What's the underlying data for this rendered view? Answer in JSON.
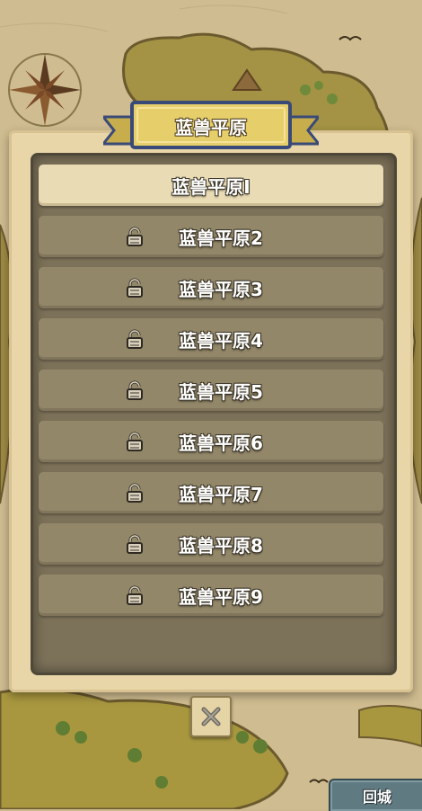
{
  "header": {
    "title": "蓝兽平原"
  },
  "levels": [
    {
      "label": "蓝兽平原Ⅰ",
      "locked": false,
      "selected": true
    },
    {
      "label": "蓝兽平原2",
      "locked": true,
      "selected": false
    },
    {
      "label": "蓝兽平原3",
      "locked": true,
      "selected": false
    },
    {
      "label": "蓝兽平原4",
      "locked": true,
      "selected": false
    },
    {
      "label": "蓝兽平原5",
      "locked": true,
      "selected": false
    },
    {
      "label": "蓝兽平原6",
      "locked": true,
      "selected": false
    },
    {
      "label": "蓝兽平原7",
      "locked": true,
      "selected": false
    },
    {
      "label": "蓝兽平原8",
      "locked": true,
      "selected": false
    },
    {
      "label": "蓝兽平原9",
      "locked": true,
      "selected": false
    }
  ],
  "footer": {
    "return_city_label": "回城"
  },
  "icons": {
    "lock": "lock-icon",
    "close": "close-icon",
    "compass": "compass-rose-icon"
  },
  "colors": {
    "panel": "#e8d6a8",
    "list_bg": "#7c7159",
    "row": "#938769",
    "row_active": "#e9dbb4",
    "banner": "#e6cf6a",
    "city_button": "#5f7a80"
  }
}
